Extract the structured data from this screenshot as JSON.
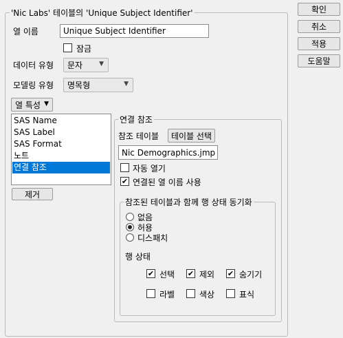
{
  "group_title": "'Nic Labs' 테이블의 'Unique Subject Identifier'",
  "column_name_label": "열 이름",
  "column_name_value": "Unique Subject Identifier",
  "lock_label": "잠금",
  "data_type_label": "데이터 유형",
  "data_type_value": "문자",
  "modeling_type_label": "모델링 유형",
  "modeling_type_value": "명목형",
  "column_props_button": "열 특성",
  "properties": [
    {
      "label": "SAS Name",
      "selected": false
    },
    {
      "label": "SAS Label",
      "selected": false
    },
    {
      "label": "SAS Format",
      "selected": false
    },
    {
      "label": "노트",
      "selected": false
    },
    {
      "label": "연결 참조",
      "selected": true
    }
  ],
  "remove_button": "제거",
  "link_ref": {
    "title": "연결 참조",
    "ref_table_label": "참조 테이블",
    "select_table_button": "테이블 선택",
    "table_value": "Nic Demographics.jmp",
    "auto_open_label": "자동 열기",
    "auto_open_checked": false,
    "use_linked_names_label": "연결된 열 이름 사용",
    "use_linked_names_checked": true,
    "sync_group_title": "참조된 테이블과 함께 행 상태 동기화",
    "sync_options": [
      {
        "label": "없음",
        "selected": false
      },
      {
        "label": "허용",
        "selected": true
      },
      {
        "label": "디스패치",
        "selected": false
      }
    ],
    "row_states_label": "행 상태",
    "row_states": [
      {
        "label": "선택",
        "checked": true
      },
      {
        "label": "제외",
        "checked": true
      },
      {
        "label": "숨기기",
        "checked": true
      },
      {
        "label": "라벨",
        "checked": false
      },
      {
        "label": "색상",
        "checked": false
      },
      {
        "label": "표식",
        "checked": false
      }
    ]
  },
  "dialog_buttons": {
    "ok": "확인",
    "cancel": "취소",
    "apply": "적용",
    "help": "도움말"
  }
}
